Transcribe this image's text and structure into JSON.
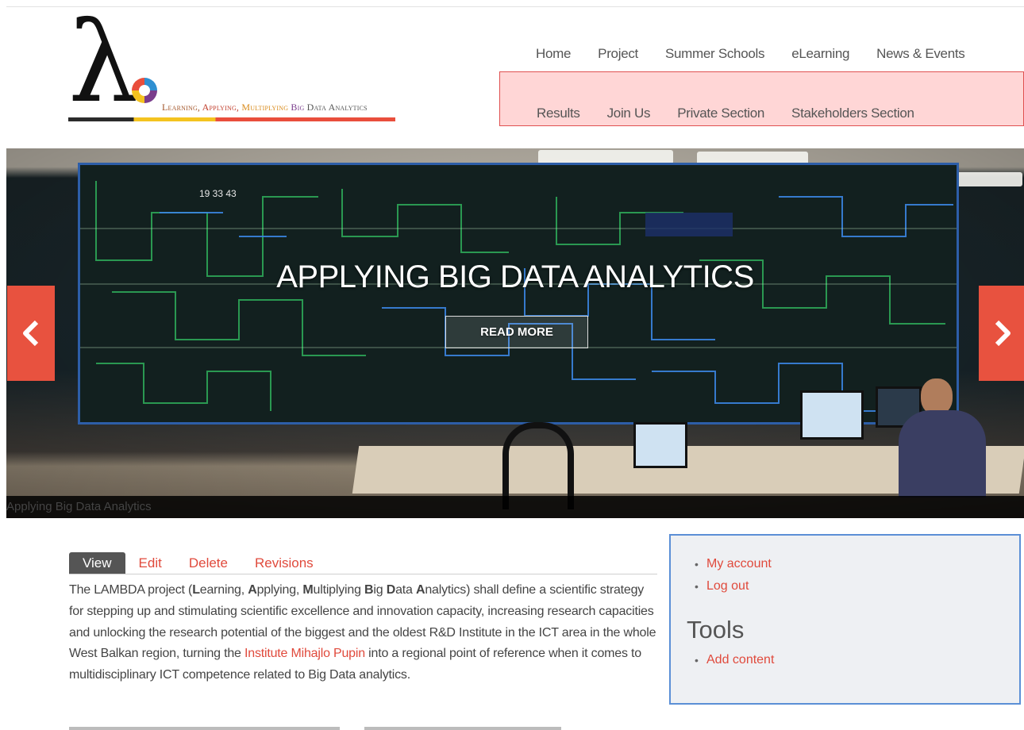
{
  "logo": {
    "symbol": "λ",
    "tagline_parts": [
      "Learning, ",
      "Applying, ",
      "Multiplying ",
      "Big ",
      "Data Analytics"
    ]
  },
  "nav": {
    "row1": [
      "Home",
      "Project",
      "Summer Schools",
      "eLearning",
      "News & Events"
    ],
    "row2": [
      "Results",
      "Join Us",
      "Private Section",
      "Stakeholders Section"
    ]
  },
  "hero": {
    "title": "APPLYING BIG DATA ANALYTICS",
    "button": "READ MORE",
    "caption": "Applying Big Data Analytics",
    "wall_counter": "19 33 43"
  },
  "tabs": [
    "View",
    "Edit",
    "Delete",
    "Revisions"
  ],
  "content": {
    "p_lead": "The LAMBDA project (",
    "L": "L",
    "L_rest": "earning, ",
    "A": "A",
    "A_rest": "pplying, ",
    "M": "M",
    "M_rest": "ultiplying ",
    "B": "B",
    "B_rest": "ig ",
    "D": "D",
    "D_rest": "ata ",
    "A2": "A",
    "A2_rest": "nalytics) shall define a scientific strategy for stepping up and stimulating scientific excellence and innovation capacity, increasing research capacities and unlocking the research potential of the biggest and the oldest R&D Institute in the ICT area in the whole West Balkan region, turning the ",
    "link": "Institute Mihajlo Pupin",
    "p_tail": " into a regional point of reference when it comes to multidisciplinary ICT competence related to Big Data analytics."
  },
  "sidebar": {
    "user_links": [
      "My account",
      "Log out"
    ],
    "tools_title": "Tools",
    "tools_links": [
      "Add content"
    ]
  },
  "colors": {
    "accent": "#e04a3c",
    "arrow_bg": "#e8523f",
    "nav_highlight_bg": "#ffd6d6",
    "sidebar_border": "#5b8fd6"
  }
}
